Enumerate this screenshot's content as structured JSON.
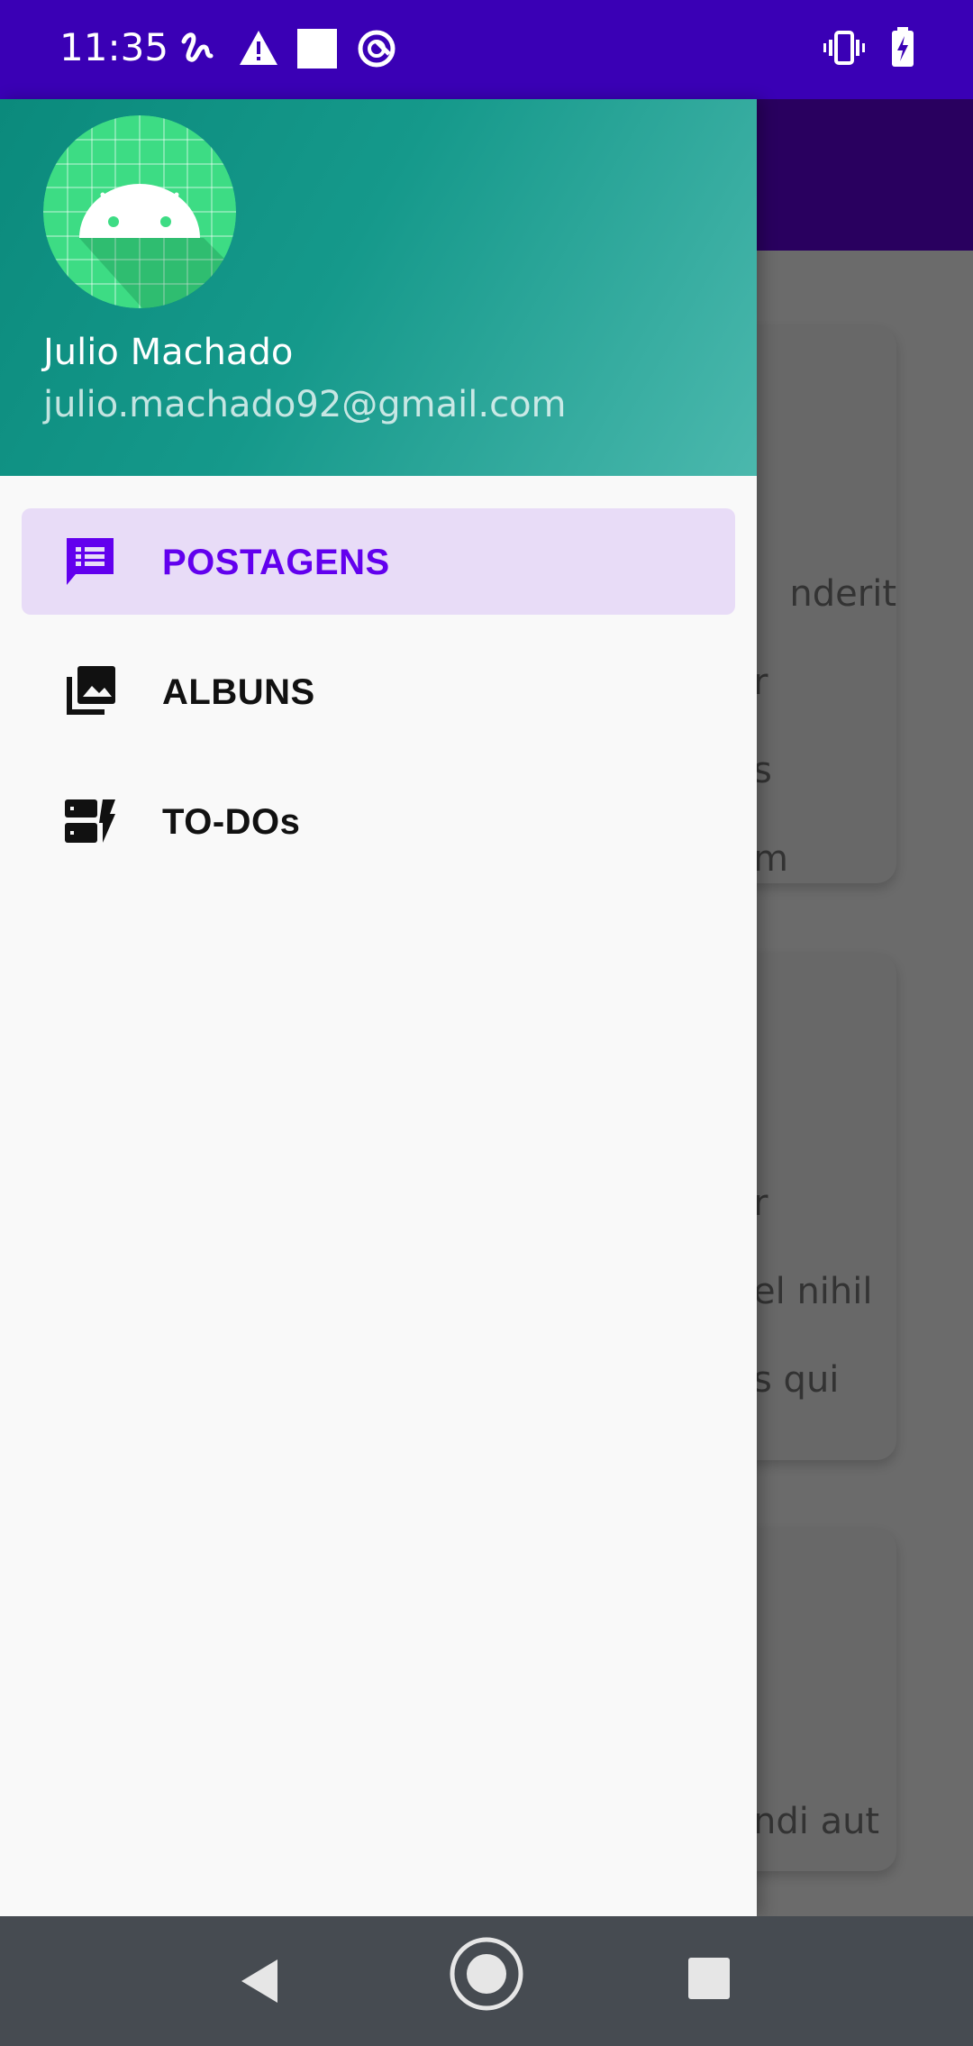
{
  "status_bar": {
    "time": "11:35",
    "left_icons": [
      "squiggle-icon",
      "warning-icon",
      "square-icon",
      "sync-circle-icon"
    ],
    "right_icons": [
      "vibrate-icon",
      "battery-charging-icon"
    ],
    "background": "#3a00b5"
  },
  "drawer": {
    "header": {
      "user_name": "Julio Machado",
      "user_email": "julio.machado92@gmail.com",
      "avatar_icon": "android-icon"
    },
    "items": [
      {
        "label": "POSTAGENS",
        "icon": "forum-list-icon",
        "active": true
      },
      {
        "label": "ALBUNS",
        "icon": "photo-library-icon",
        "active": false
      },
      {
        "label": "TO-DOs",
        "icon": "dynamic-form-icon",
        "active": false
      }
    ],
    "accent_color": "#6200ee"
  },
  "background_content": {
    "card_1_lines": [
      "nderit",
      "r",
      "s",
      "m"
    ],
    "card_2_lines": [
      "r",
      "el nihil",
      "s qui"
    ],
    "card_3_lines": [
      "",
      "ndi aut"
    ]
  },
  "nav_bar": {
    "buttons": [
      "back-icon",
      "home-icon",
      "recents-icon"
    ]
  }
}
